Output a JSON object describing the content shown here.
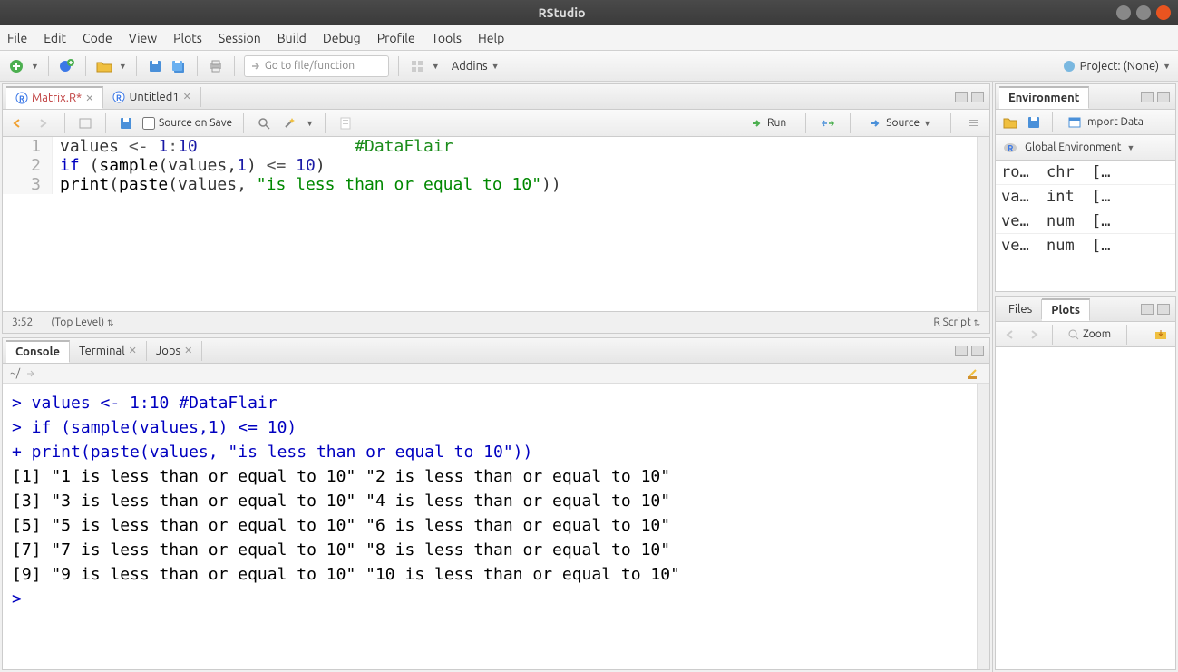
{
  "window": {
    "title": "RStudio"
  },
  "menu": [
    "File",
    "Edit",
    "Code",
    "View",
    "Plots",
    "Session",
    "Build",
    "Debug",
    "Profile",
    "Tools",
    "Help"
  ],
  "toolbar": {
    "goto_placeholder": "Go to file/function",
    "addins": "Addins",
    "project": "Project: (None)"
  },
  "editor": {
    "tabs": [
      {
        "label": "Matrix.R*",
        "active": true,
        "dirty": true
      },
      {
        "label": "Untitled1",
        "active": false
      }
    ],
    "source_on_save": "Source on Save",
    "run": "Run",
    "source": "Source",
    "lines": [
      {
        "n": "1",
        "tokens": [
          [
            "pl",
            "values "
          ],
          [
            "op",
            "<-"
          ],
          [
            "pl",
            " "
          ],
          [
            "num",
            "1"
          ],
          [
            "op",
            ":"
          ],
          [
            "num",
            "10"
          ],
          [
            "pl",
            "                "
          ],
          [
            "cmt",
            "#DataFlair"
          ]
        ]
      },
      {
        "n": "2",
        "tokens": [
          [
            "kw",
            "if"
          ],
          [
            "pl",
            " ("
          ],
          [
            "fn",
            "sample"
          ],
          [
            "pl",
            "(values,"
          ],
          [
            "num",
            "1"
          ],
          [
            "pl",
            ") "
          ],
          [
            "op",
            "<="
          ],
          [
            "pl",
            " "
          ],
          [
            "num",
            "10"
          ],
          [
            "pl",
            ")"
          ]
        ]
      },
      {
        "n": "3",
        "tokens": [
          [
            "fn",
            "print"
          ],
          [
            "pl",
            "("
          ],
          [
            "fn",
            "paste"
          ],
          [
            "pl",
            "(values, "
          ],
          [
            "str",
            "\"is less than or equal to 10\""
          ],
          [
            "pl",
            "))"
          ]
        ]
      }
    ],
    "status_left": "3:52",
    "status_scope": "(Top Level)",
    "status_right": "R Script"
  },
  "console": {
    "tabs": [
      "Console",
      "Terminal",
      "Jobs"
    ],
    "active_tab": 0,
    "path": "~/",
    "lines": [
      {
        "cls": "pr",
        "text": "> values <- 1:10               #DataFlair"
      },
      {
        "cls": "pr",
        "text": "> if (sample(values,1) <= 10)"
      },
      {
        "cls": "pr",
        "text": "+ print(paste(values, \"is less than or equal to 10\"))"
      },
      {
        "cls": "out",
        "text": " [1] \"1 is less than or equal to 10\"  \"2 is less than or equal to 10\" "
      },
      {
        "cls": "out",
        "text": " [3] \"3 is less than or equal to 10\"  \"4 is less than or equal to 10\" "
      },
      {
        "cls": "out",
        "text": " [5] \"5 is less than or equal to 10\"  \"6 is less than or equal to 10\" "
      },
      {
        "cls": "out",
        "text": " [7] \"7 is less than or equal to 10\"  \"8 is less than or equal to 10\" "
      },
      {
        "cls": "out",
        "text": " [9] \"9 is less than or equal to 10\"  \"10 is less than or equal to 10\""
      },
      {
        "cls": "pr",
        "text": "> "
      }
    ]
  },
  "env": {
    "tab": "Environment",
    "import": "Import Data",
    "scope": "Global Environment",
    "rows": [
      {
        "name": "ro…",
        "type": "chr",
        "val": "[…"
      },
      {
        "name": "va…",
        "type": "int",
        "val": "[…"
      },
      {
        "name": "ve…",
        "type": "num",
        "val": "[…"
      },
      {
        "name": "ve…",
        "type": "num",
        "val": "[…"
      }
    ]
  },
  "bottomright": {
    "tabs": [
      "Files",
      "Plots"
    ],
    "active_tab": 1,
    "zoom": "Zoom"
  }
}
